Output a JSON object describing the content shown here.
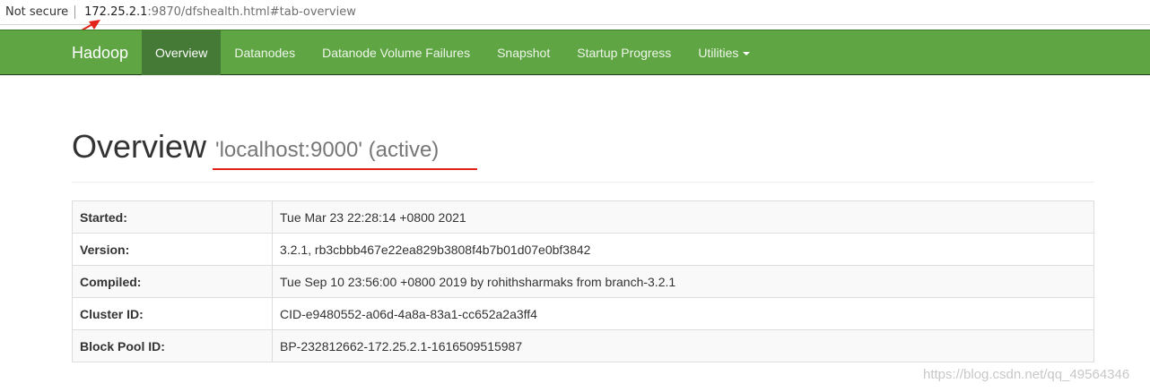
{
  "address_bar": {
    "security_label": "Not secure",
    "url_host": "172.25.2.1",
    "url_rest": ":9870/dfshealth.html#tab-overview"
  },
  "navbar": {
    "brand": "Hadoop",
    "items": [
      {
        "label": "Overview",
        "active": true
      },
      {
        "label": "Datanodes"
      },
      {
        "label": "Datanode Volume Failures"
      },
      {
        "label": "Snapshot"
      },
      {
        "label": "Startup Progress"
      },
      {
        "label": "Utilities",
        "dropdown": true
      }
    ]
  },
  "header": {
    "title": "Overview",
    "subtitle": "'localhost:9000' (active)"
  },
  "info_table": [
    {
      "key": "Started:",
      "value": "Tue Mar 23 22:28:14 +0800 2021"
    },
    {
      "key": "Version:",
      "value": "3.2.1, rb3cbbb467e22ea829b3808f4b7b01d07e0bf3842"
    },
    {
      "key": "Compiled:",
      "value": "Tue Sep 10 23:56:00 +0800 2019 by rohithsharmaks from branch-3.2.1"
    },
    {
      "key": "Cluster ID:",
      "value": "CID-e9480552-a06d-4a8a-83a1-cc652a2a3ff4"
    },
    {
      "key": "Block Pool ID:",
      "value": "BP-232812662-172.25.2.1-1616509515987"
    }
  ],
  "watermark": "https://blog.csdn.net/qq_49564346",
  "colors": {
    "navbar": "#5fa544",
    "navbar_active": "#447a36",
    "annotation_red": "#e2231a"
  }
}
